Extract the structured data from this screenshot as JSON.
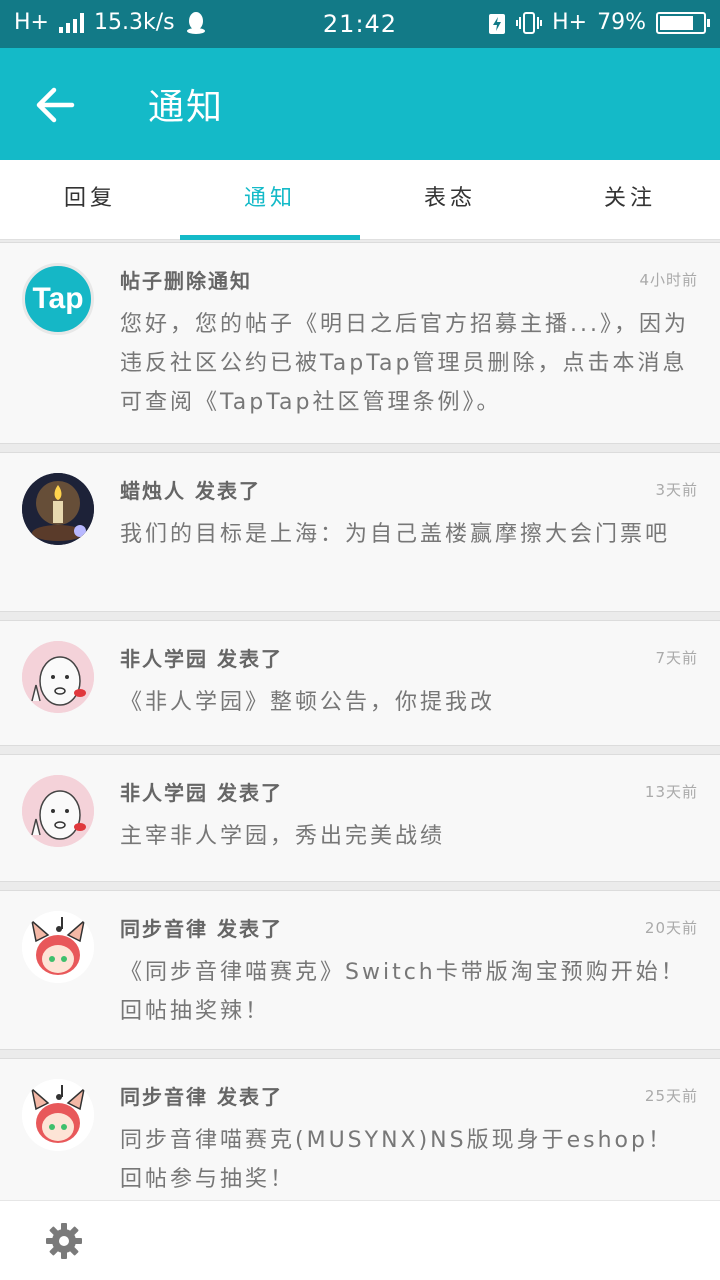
{
  "status_bar": {
    "network": "H+",
    "speed": "15.3k/s",
    "time": "21:42",
    "network_right": "H+",
    "battery_pct": "79%",
    "battery_level": 0.79
  },
  "header": {
    "title": "通知"
  },
  "tabs": [
    {
      "label": "回复",
      "active": false
    },
    {
      "label": "通知",
      "active": true
    },
    {
      "label": "表态",
      "active": false
    },
    {
      "label": "关注",
      "active": false
    }
  ],
  "notifications": [
    {
      "avatar": "taptap-logo",
      "avatar_text": "Tap",
      "title": "帖子删除通知",
      "time": "4小时前",
      "body": "您好，您的帖子《明日之后官方招募主播...》，因为违反社区公约已被TapTap管理员删除，点击本消息可查阅《TapTap社区管理条例》。"
    },
    {
      "avatar": "candleman-avatar",
      "title": "蜡烛人 发表了",
      "time": "3天前",
      "body": "我们的目标是上海：为自己盖楼赢摩擦大会门票吧"
    },
    {
      "avatar": "cartoon-face-avatar",
      "title": "非人学园 发表了",
      "time": "7天前",
      "body": "《非人学园》整顿公告，你提我改"
    },
    {
      "avatar": "cartoon-face-avatar",
      "title": "非人学园 发表了",
      "time": "13天前",
      "body": "主宰非人学园，秀出完美战绩"
    },
    {
      "avatar": "anime-girl-avatar",
      "title": "同步音律 发表了",
      "time": "20天前",
      "body": "《同步音律喵赛克》Switch卡带版淘宝预购开始！回帖抽奖辣！"
    },
    {
      "avatar": "anime-girl-avatar",
      "title": "同步音律 发表了",
      "time": "25天前",
      "body": "同步音律喵赛克(MUSYNX)NS版现身于eshop！回帖参与抽奖！"
    }
  ],
  "colors": {
    "accent": "#14bac8",
    "status_bar": "#127a87"
  }
}
